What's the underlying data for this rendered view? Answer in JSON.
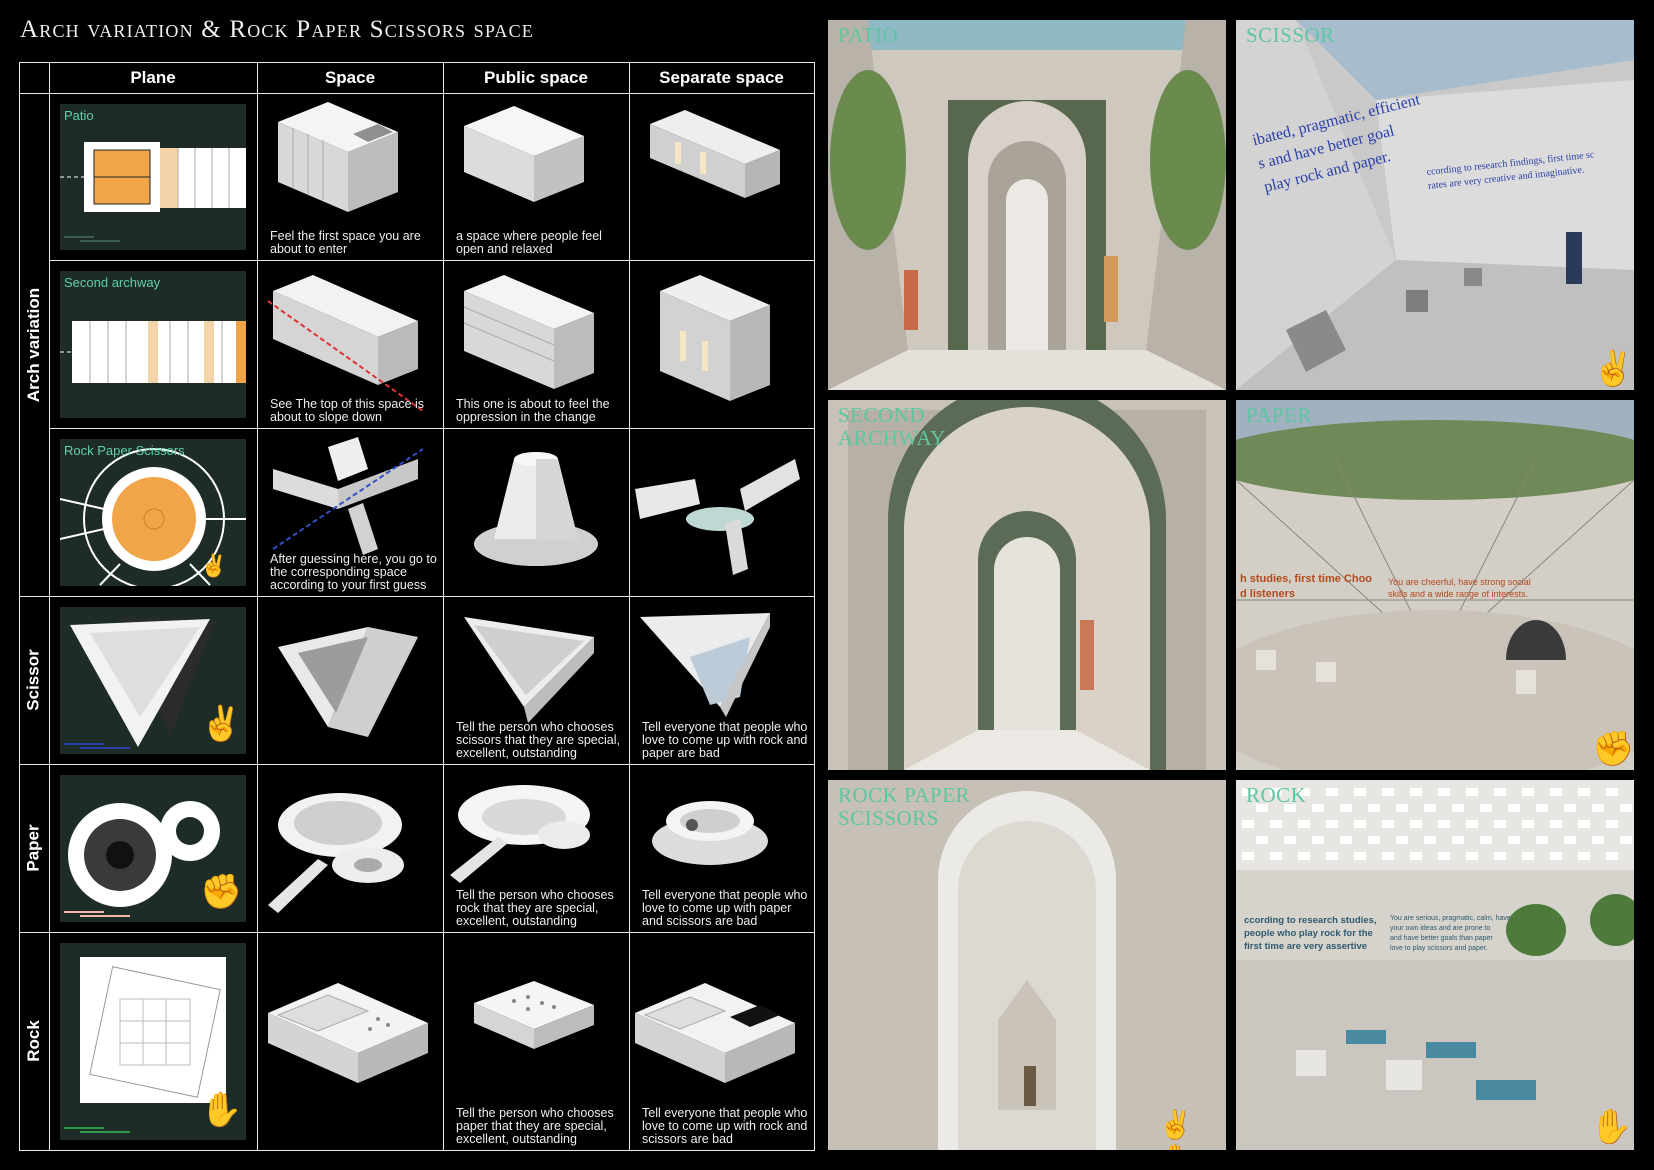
{
  "title": "Arch variation & Rock Paper Scissors space",
  "columns": [
    "Plane",
    "Space",
    "Public space",
    "Separate space"
  ],
  "row_groups": [
    {
      "label": "Arch variation"
    },
    {
      "label": "Scissor"
    },
    {
      "label": "Paper"
    },
    {
      "label": "Rock"
    }
  ],
  "rows": [
    {
      "plan_label": "Patio",
      "captions": [
        "Feel the first space you are about to enter",
        "a space where people feel open and relaxed",
        ""
      ]
    },
    {
      "plan_label": "Second archway",
      "captions": [
        "See The top of this space is about to slope down",
        "This one is about to feel the oppression in the change",
        ""
      ]
    },
    {
      "plan_label": "Rock Paper Scissors",
      "captions": [
        "After guessing here, you go to the corresponding space according to your first guess",
        "",
        ""
      ]
    },
    {
      "plan_label": "",
      "captions": [
        "",
        "Tell the person who chooses scissors that they are special, excellent, outstanding",
        "Tell everyone that people who love to come up with rock and paper are bad"
      ]
    },
    {
      "plan_label": "",
      "captions": [
        "",
        "Tell the person who chooses rock that they are special, excellent, outstanding",
        "Tell everyone that people who love to come up with paper and scissors are bad"
      ]
    },
    {
      "plan_label": "",
      "captions": [
        "",
        "Tell the person who chooses paper that they are special, excellent, outstanding",
        "Tell everyone that people who love to come up with rock and scissors are bad"
      ]
    }
  ],
  "renders": [
    {
      "label": "PATIO"
    },
    {
      "label": "SCISSOR"
    },
    {
      "label": "SECOND\nARCHWAY"
    },
    {
      "label": "PAPER"
    },
    {
      "label": "ROCK PAPER\nSCISSORS"
    },
    {
      "label": "ROCK"
    }
  ],
  "render_texts": {
    "scissor": [
      "ibated, pragmatic, efficient",
      "s and have better goal",
      "play rock and paper.",
      "ccording to research findings, first time sc",
      "rates are very creative and imaginative."
    ],
    "paper": [
      "h studies, first time Choo",
      "d listeners",
      "You are cheerful, have strong social",
      "skills and a wide range of interests."
    ],
    "rock": [
      "ccording to research studies,",
      "people who play rock for the",
      "first time are very assertive",
      "You are serious, pragmatic, calm, have",
      "your own ideas and are prone to",
      "and have better goals than paper",
      "love to play scissors and paper."
    ]
  },
  "icons": {
    "scissors": "scissors-hand-icon",
    "paper": "fist-hand-icon",
    "rock": "open-hand-icon"
  },
  "colors": {
    "accent_green": "#5fd1a9",
    "plan_bg": "#1d2c27",
    "orange": "#f0a548",
    "blue_hand": "#2a3fa8",
    "green_hand": "#2e9a4a",
    "pink_hand": "#f2b7a6"
  }
}
